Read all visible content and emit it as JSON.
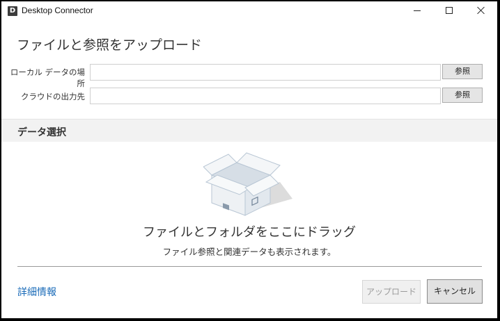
{
  "window": {
    "app_icon_letter": "D",
    "title": "Desktop Connector"
  },
  "main": {
    "heading": "ファイルと参照をアップロード",
    "local_label": "ローカル データの場所",
    "local_value": "",
    "local_browse": "参照",
    "cloud_label": "クラウドの出力先",
    "cloud_value": "",
    "cloud_browse": "参照"
  },
  "data_section": {
    "title": "データ選択",
    "drop_title": "ファイルとフォルダをここにドラッグ",
    "drop_subtitle": "ファイル参照と関連データも表示されます。"
  },
  "footer": {
    "details_link": "詳細情報",
    "upload_label": "アップロード",
    "cancel_label": "キャンセル"
  },
  "colors": {
    "link": "#1a6bb8",
    "section_band": "#f2f2f2",
    "window_border": "#000000"
  }
}
